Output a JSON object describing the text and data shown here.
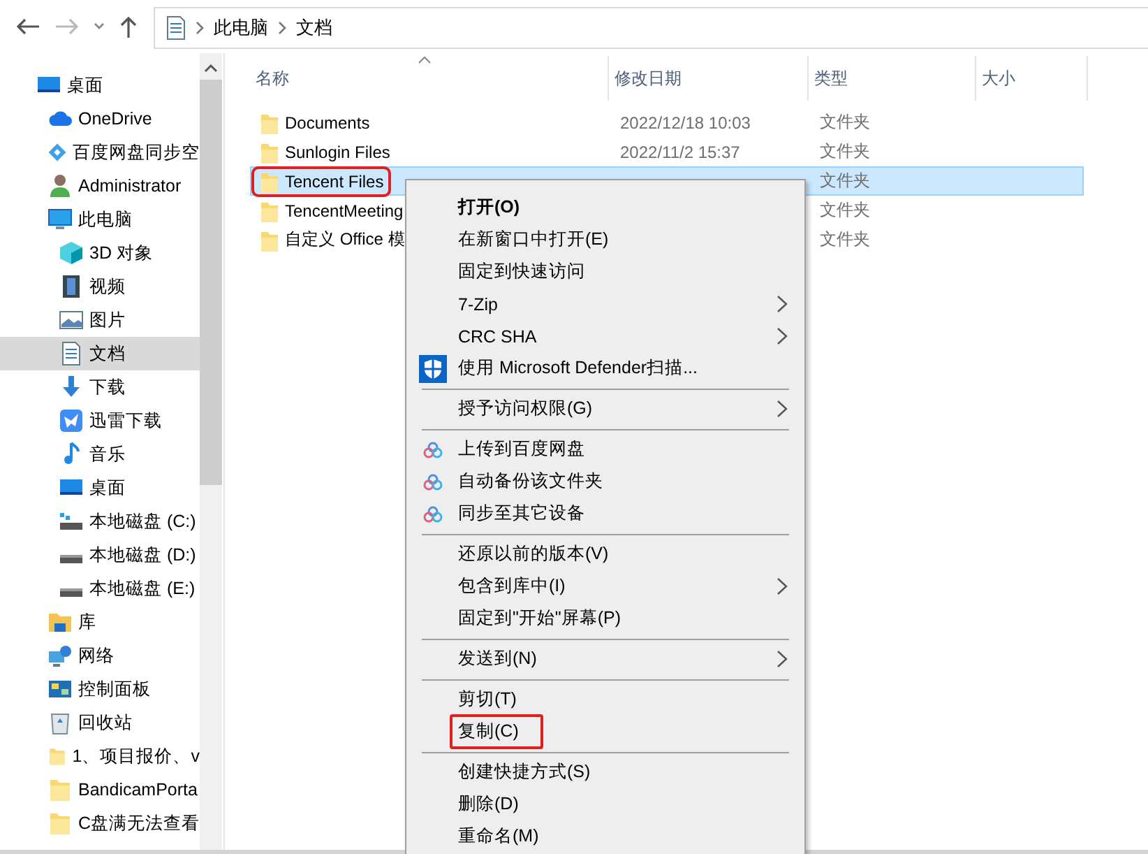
{
  "address_bar": {
    "path": [
      "此电脑",
      "文档"
    ]
  },
  "sidebar": {
    "items": [
      {
        "label": "桌面",
        "kind": "desktop",
        "selected": false,
        "children": [
          {
            "label": "OneDrive",
            "kind": "cloud",
            "selected": false
          },
          {
            "label": "百度网盘同步空",
            "kind": "sync",
            "selected": false
          },
          {
            "label": "Administrator",
            "kind": "user",
            "selected": false
          },
          {
            "label": "此电脑",
            "kind": "computer",
            "selected": false,
            "children": [
              {
                "label": "3D 对象",
                "kind": "cube",
                "selected": false
              },
              {
                "label": "视频",
                "kind": "film",
                "selected": false
              },
              {
                "label": "图片",
                "kind": "image",
                "selected": false
              },
              {
                "label": "文档",
                "kind": "document",
                "selected": true
              },
              {
                "label": "下载",
                "kind": "download",
                "selected": false
              },
              {
                "label": "迅雷下载",
                "kind": "bird",
                "selected": false
              },
              {
                "label": "音乐",
                "kind": "music",
                "selected": false
              },
              {
                "label": "桌面",
                "kind": "desktop",
                "selected": false
              },
              {
                "label": "本地磁盘 (C:)",
                "kind": "sysdrive",
                "selected": false
              },
              {
                "label": "本地磁盘 (D:)",
                "kind": "drive",
                "selected": false
              },
              {
                "label": "本地磁盘 (E:)",
                "kind": "drive",
                "selected": false
              }
            ]
          },
          {
            "label": "库",
            "kind": "library",
            "selected": false
          },
          {
            "label": "网络",
            "kind": "network",
            "selected": false
          },
          {
            "label": "控制面板",
            "kind": "panel",
            "selected": false
          },
          {
            "label": "回收站",
            "kind": "bin",
            "selected": false
          },
          {
            "label": "1、项目报价、v",
            "kind": "folder",
            "selected": false
          },
          {
            "label": "BandicamPorta",
            "kind": "folder",
            "selected": false
          },
          {
            "label": "C盘满无法查看",
            "kind": "folder",
            "selected": false
          }
        ]
      }
    ]
  },
  "file_list": {
    "columns": [
      "名称",
      "修改日期",
      "类型",
      "大小"
    ],
    "rows": [
      {
        "name": "Documents",
        "modified": "2022/12/18 10:03",
        "type": "文件夹",
        "selected": false,
        "annotated": false
      },
      {
        "name": "Sunlogin Files",
        "modified": "2022/11/2 15:37",
        "type": "文件夹",
        "selected": false,
        "annotated": false
      },
      {
        "name": "Tencent Files",
        "type": "文件夹",
        "selected": true,
        "annotated": true
      },
      {
        "name": "TencentMeeting",
        "type": "文件夹",
        "selected": false,
        "annotated": false
      },
      {
        "name": "自定义 Office 模",
        "type": "文件夹",
        "selected": false,
        "annotated": false
      }
    ]
  },
  "context_menu": {
    "items": [
      {
        "kind": "item",
        "label": "打开(O)",
        "default": true,
        "submenu": false,
        "annotated": false
      },
      {
        "kind": "item",
        "label": "在新窗口中打开(E)",
        "default": false,
        "submenu": false,
        "annotated": false
      },
      {
        "kind": "item",
        "label": "固定到快速访问",
        "default": false,
        "submenu": false,
        "annotated": false
      },
      {
        "kind": "item",
        "label": "7-Zip",
        "default": false,
        "submenu": true,
        "annotated": false
      },
      {
        "kind": "item",
        "label": "CRC SHA",
        "default": false,
        "submenu": true,
        "annotated": false
      },
      {
        "kind": "scan",
        "label": "使用 Microsoft Defender扫描...",
        "default": false,
        "submenu": false,
        "annotated": false
      },
      {
        "kind": "separator"
      },
      {
        "kind": "item",
        "label": "授予访问权限(G)",
        "default": false,
        "submenu": true,
        "annotated": false
      },
      {
        "kind": "separator"
      },
      {
        "kind": "sync",
        "label": "上传到百度网盘",
        "default": false,
        "submenu": false,
        "annotated": false
      },
      {
        "kind": "sync",
        "label": "自动备份该文件夹",
        "default": false,
        "submenu": false,
        "annotated": false
      },
      {
        "kind": "sync",
        "label": "同步至其它设备",
        "default": false,
        "submenu": false,
        "annotated": false
      },
      {
        "kind": "separator"
      },
      {
        "kind": "item",
        "label": "还原以前的版本(V)",
        "default": false,
        "submenu": false,
        "annotated": false
      },
      {
        "kind": "item",
        "label": "包含到库中(I)",
        "default": false,
        "submenu": true,
        "annotated": false
      },
      {
        "kind": "item",
        "label": "固定到\"开始\"屏幕(P)",
        "default": false,
        "submenu": false,
        "annotated": false
      },
      {
        "kind": "separator"
      },
      {
        "kind": "item",
        "label": "发送到(N)",
        "default": false,
        "submenu": true,
        "annotated": false
      },
      {
        "kind": "separator"
      },
      {
        "kind": "item",
        "label": "剪切(T)",
        "default": false,
        "submenu": false,
        "annotated": false
      },
      {
        "kind": "item",
        "label": "复制(C)",
        "default": false,
        "submenu": false,
        "annotated": true
      },
      {
        "kind": "separator"
      },
      {
        "kind": "item",
        "label": "创建快捷方式(S)",
        "default": false,
        "submenu": false,
        "annotated": false
      },
      {
        "kind": "item",
        "label": "删除(D)",
        "default": false,
        "submenu": false,
        "annotated": false
      },
      {
        "kind": "item",
        "label": "重命名(M)",
        "default": false,
        "submenu": false,
        "annotated": false
      }
    ]
  }
}
